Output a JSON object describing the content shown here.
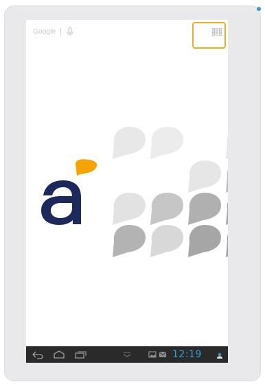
{
  "search_bar": {
    "brand_text": "Google",
    "icons": [
      "microphone-icon"
    ]
  },
  "apps_button": {
    "icon": "apps-grid-icon",
    "highlight_color": "#f0ad1e"
  },
  "wallpaper": {
    "logo_letter": "a",
    "logo_color": "#1b2a5b",
    "logo_accent_color": "#f6a400"
  },
  "status_bar": {
    "time": "12:19",
    "time_color": "#2f9fd4",
    "nav_icons": [
      "back-icon",
      "home-icon",
      "recent-apps-icon"
    ],
    "notification_icons": [
      "chevron-down-icon",
      "image-notification-icon",
      "email-notification-icon",
      "user-notification-icon"
    ]
  }
}
